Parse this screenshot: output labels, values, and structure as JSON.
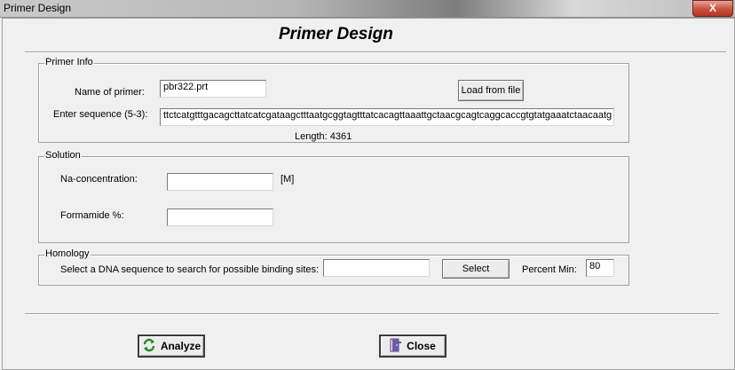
{
  "window": {
    "title": "Primer Design",
    "close_label": "X"
  },
  "header": {
    "title": "Primer Design"
  },
  "primer_info": {
    "legend": "Primer Info",
    "name_label": "Name of primer:",
    "name_value": "pbr322.prt",
    "sequence_label": "Enter sequence (5-3):",
    "sequence_value": "ttctcatgtttgacagcttatcatcgataagctttaatgcggtagtttatcacagttaaattgctaacgcagtcaggcaccgtgtatgaaatctaacaatg",
    "length_text": "Length: 4361",
    "load_button": "Load from file"
  },
  "solution": {
    "legend": "Solution",
    "na_label": "Na-concentration:",
    "na_value": "",
    "na_unit": "[M]",
    "formamide_label": "Formamide %:",
    "formamide_value": ""
  },
  "homology": {
    "legend": "Homology",
    "select_label": "Select a DNA sequence to search for possible binding sites:",
    "sequence_value": "",
    "select_button": "Select",
    "percent_label": "Percent Min:",
    "percent_value": "80"
  },
  "footer": {
    "analyze_button": "Analyze",
    "close_button": "Close"
  }
}
